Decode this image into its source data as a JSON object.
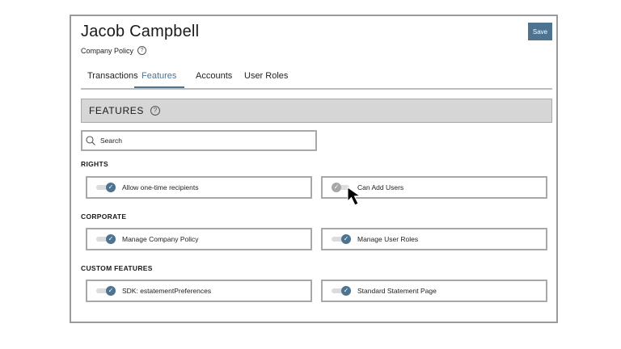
{
  "header": {
    "title": "Jacob Campbell",
    "subtitle": "Company Policy",
    "help_glyph": "?",
    "save_label": "Save"
  },
  "tabs": [
    {
      "label": "Transactions",
      "active": false
    },
    {
      "label": "Features",
      "active": true
    },
    {
      "label": "Accounts",
      "active": false
    },
    {
      "label": "User Roles",
      "active": false
    }
  ],
  "features": {
    "title": "FEATURES",
    "search_placeholder": "Search"
  },
  "sections": [
    {
      "label": "RIGHTS",
      "items": [
        {
          "label": "Allow one-time recipients",
          "enabled": true
        },
        {
          "label": "Can Add Users",
          "enabled": false
        }
      ]
    },
    {
      "label": "CORPORATE",
      "items": [
        {
          "label": "Manage Company Policy",
          "enabled": true
        },
        {
          "label": "Manage User Roles",
          "enabled": true
        }
      ]
    },
    {
      "label": "CUSTOM FEATURES",
      "items": [
        {
          "label": "SDK: estatementPreferences",
          "enabled": true
        },
        {
          "label": "Standard Statement Page",
          "enabled": true
        }
      ]
    }
  ],
  "colors": {
    "accent": "#4c7390",
    "toggle_off": "#a6a6a6",
    "border": "#a8a8a8"
  },
  "icons": {
    "help": "help-circle-icon",
    "search": "magnifier-icon",
    "toggle_on": "check-icon",
    "cursor": "mouse-pointer-icon"
  }
}
